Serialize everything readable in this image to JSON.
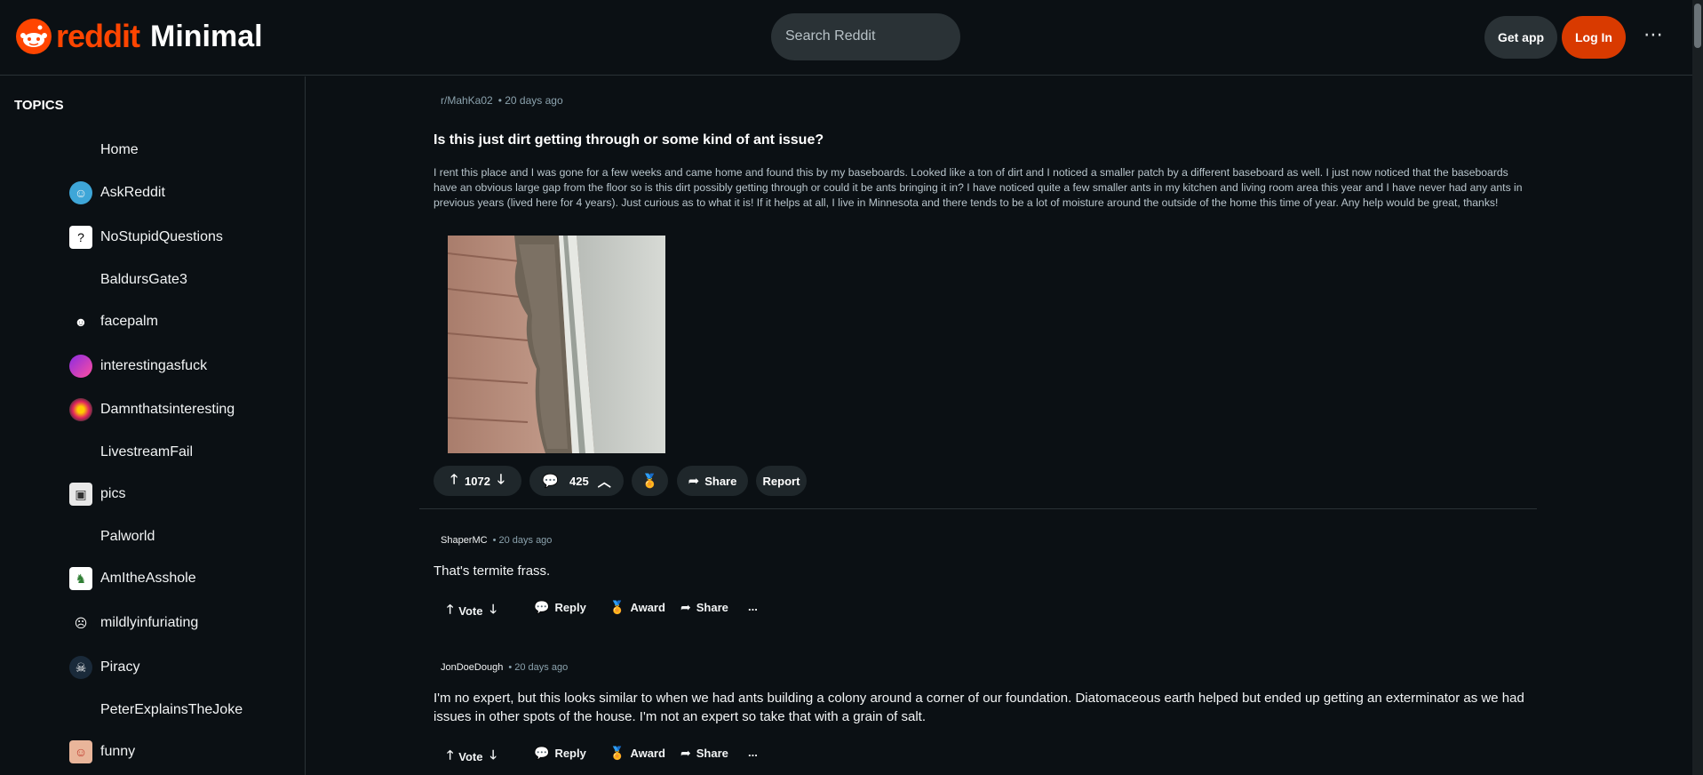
{
  "header": {
    "logo_word": "reddit",
    "logo_sub": "Minimal",
    "search_placeholder": "Search Reddit",
    "get_app": "Get app",
    "log_in": "Log In",
    "more": "⋯"
  },
  "sidebar": {
    "heading": "TOPICS",
    "items": [
      {
        "label": "Home",
        "icon": "none"
      },
      {
        "label": "AskReddit",
        "icon": "askreddit-avatar"
      },
      {
        "label": "NoStupidQuestions",
        "icon": "question-icon"
      },
      {
        "label": "BaldursGate3",
        "icon": "none"
      },
      {
        "label": "facepalm",
        "icon": "facepalm-avatar"
      },
      {
        "label": "interestingasfuck",
        "icon": "interesting-avatar"
      },
      {
        "label": "Damnthatsinteresting",
        "icon": "damn-avatar"
      },
      {
        "label": "LivestreamFail",
        "icon": "none"
      },
      {
        "label": "pics",
        "icon": "pics-avatar"
      },
      {
        "label": "Palworld",
        "icon": "none"
      },
      {
        "label": "AmItheAsshole",
        "icon": "aita-avatar"
      },
      {
        "label": "mildlyinfuriating",
        "icon": "mildly-avatar"
      },
      {
        "label": "Piracy",
        "icon": "skull-icon"
      },
      {
        "label": "PeterExplainsTheJoke",
        "icon": "none"
      },
      {
        "label": "funny",
        "icon": "funny-avatar"
      }
    ]
  },
  "post": {
    "subreddit": "r/MahKa02",
    "time": "• 20 days ago",
    "title": "Is this just dirt getting through or some kind of ant issue?",
    "body": "I rent this place and I was gone for a few weeks and came home and found this by my baseboards. Looked like a ton of dirt and I noticed a smaller patch by a different baseboard as well. I just now noticed that the baseboards have an obvious large gap from the floor so is this dirt possibly getting through or could it be ants bringing it in? I have noticed quite a few smaller ants in my kitchen and living room area this year and I have never had any ants in previous years (lived here for 4 years). Just curious as to what it is! If it helps at all, I live in Minnesota and there tends to be a lot of moisture around the outside of the home this time of year. Any help would be great, thanks!",
    "votes": "1072",
    "comments": "425",
    "share": "Share",
    "report": "Report"
  },
  "comments": [
    {
      "author": "ShaperMC",
      "time": "• 20 days ago",
      "text": "That's termite frass.",
      "vote": "Vote",
      "reply": "Reply",
      "award": "Award",
      "share": "Share",
      "more": "..."
    },
    {
      "author": "JonDoeDough",
      "time": "• 20 days ago",
      "text": "I'm no expert, but this looks similar to when we had ants building a colony around a corner of our foundation.  Diatomaceous earth helped but ended up getting an exterminator as we had issues in other spots of the house.  I'm not an expert so take that with a grain of salt.",
      "vote": "Vote",
      "reply": "Reply",
      "award": "Award",
      "share": "Share",
      "more": "..."
    }
  ],
  "colors": {
    "brand": "#ff4500",
    "login_bg": "#d93a00",
    "bg": "#0b1014",
    "pill_bg": "#1f272b"
  }
}
